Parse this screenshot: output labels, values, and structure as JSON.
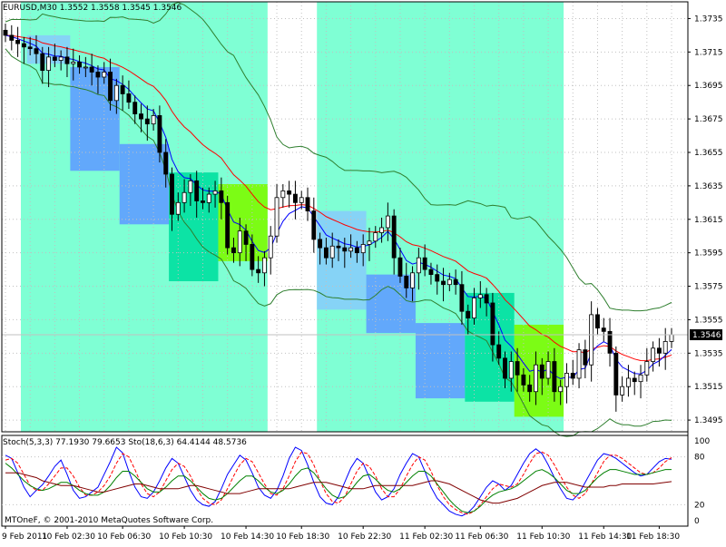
{
  "header": {
    "symbol_label": "EURUSD,M30  1.3552 1.3558 1.3545 1.3546"
  },
  "indicator_header": {
    "label": "Stoch(5,3,3) 77.1930 79.6653  Sto(18,6,3) 64.4144 48.5736"
  },
  "watermark": "MTOneF, © 2001-2010 MetaQuotes Software Corp.",
  "colors": {
    "background": "#ffffff",
    "grid": "#c0c0c0",
    "bull_candle": "#ffffff",
    "bear_candle": "#000000",
    "upper_band": "#2f7f2f",
    "lower_band": "#2f7f2f",
    "ema_red": "#ff0000",
    "ema_blue": "#0000ff",
    "session_zone": "#7fffd4",
    "box_blue": "#5f9fff",
    "box_lightblue": "#87cefa",
    "box_teal": "#00e0a0",
    "box_green": "#7cfc00",
    "stoch_main": "#0000ff",
    "stoch_signal": "#ff0000",
    "sto_slow": "#008000",
    "sto_slow_signal": "#800000"
  },
  "chart_data": [
    {
      "type": "candlestick",
      "title": "EURUSD,M30",
      "ylim": [
        1.3488,
        1.3745
      ],
      "y_ticks": [
        "1.3735",
        "1.3715",
        "1.3695",
        "1.3675",
        "1.3655",
        "1.3635",
        "1.3615",
        "1.3595",
        "1.3575",
        "1.3555",
        "1.3535",
        "1.3515",
        "1.3495"
      ],
      "current_price_label": "1.3546",
      "current_price": 1.3546,
      "x_tick_labels": [
        "9 Feb 2011",
        "10 Feb 02:30",
        "10 Feb 06:30",
        "10 Feb 10:30",
        "10 Feb 14:30",
        "10 Feb 18:30",
        "10 Feb 22:30",
        "11 Feb 02:30",
        "11 Feb 06:30",
        "11 Feb 10:30",
        "11 Feb 14:30",
        "11 Feb 18:30"
      ],
      "close": [
        1.3725,
        1.3722,
        1.372,
        1.3718,
        1.3717,
        1.3714,
        1.3704,
        1.3712,
        1.371,
        1.3712,
        1.3708,
        1.3709,
        1.3706,
        1.3706,
        1.3703,
        1.37,
        1.3703,
        1.3686,
        1.3695,
        1.369,
        1.3685,
        1.3678,
        1.3675,
        1.3672,
        1.3677,
        1.3655,
        1.3642,
        1.3618,
        1.3625,
        1.3631,
        1.3638,
        1.3626,
        1.3625,
        1.363,
        1.3632,
        1.3625,
        1.3598,
        1.3595,
        1.3608,
        1.36,
        1.3585,
        1.3583,
        1.3592,
        1.3605,
        1.3628,
        1.3632,
        1.363,
        1.3625,
        1.3628,
        1.362,
        1.3603,
        1.3598,
        1.3592,
        1.3599,
        1.3598,
        1.3596,
        1.3598,
        1.3595,
        1.36,
        1.3602,
        1.3607,
        1.361,
        1.3617,
        1.3592,
        1.3581,
        1.3574,
        1.3583,
        1.3592,
        1.3585,
        1.3582,
        1.3578,
        1.3576,
        1.3579,
        1.3576,
        1.356,
        1.3556,
        1.3568,
        1.357,
        1.3565,
        1.354,
        1.3532,
        1.352,
        1.353,
        1.3522,
        1.3516,
        1.3512,
        1.3528,
        1.352,
        1.353,
        1.3512,
        1.3515,
        1.3523,
        1.352,
        1.3537,
        1.3528,
        1.3558,
        1.355,
        1.3548,
        1.3535,
        1.351,
        1.3515,
        1.352,
        1.3518,
        1.3522,
        1.353,
        1.3538,
        1.3535,
        1.3542,
        1.3546
      ],
      "open": [
        1.3728,
        1.3725,
        1.3722,
        1.372,
        1.3718,
        1.3717,
        1.3714,
        1.3704,
        1.3712,
        1.371,
        1.3712,
        1.3708,
        1.3709,
        1.3706,
        1.3706,
        1.3703,
        1.37,
        1.3703,
        1.3686,
        1.3695,
        1.369,
        1.3685,
        1.3678,
        1.3675,
        1.3672,
        1.3677,
        1.3655,
        1.3642,
        1.3618,
        1.3625,
        1.3631,
        1.3638,
        1.3626,
        1.3625,
        1.363,
        1.3632,
        1.3625,
        1.3598,
        1.3595,
        1.3608,
        1.36,
        1.3585,
        1.3583,
        1.3592,
        1.3605,
        1.3628,
        1.3632,
        1.363,
        1.3625,
        1.3628,
        1.362,
        1.3603,
        1.3598,
        1.3592,
        1.3599,
        1.3598,
        1.3596,
        1.3598,
        1.3595,
        1.36,
        1.3602,
        1.3607,
        1.361,
        1.3617,
        1.3592,
        1.3581,
        1.3574,
        1.3583,
        1.3592,
        1.3585,
        1.3582,
        1.3578,
        1.3576,
        1.3579,
        1.3576,
        1.356,
        1.3556,
        1.3568,
        1.357,
        1.3565,
        1.354,
        1.3532,
        1.352,
        1.353,
        1.3522,
        1.3516,
        1.3512,
        1.3528,
        1.352,
        1.353,
        1.3512,
        1.3515,
        1.3523,
        1.352,
        1.3537,
        1.3528,
        1.3558,
        1.355,
        1.3548,
        1.3535,
        1.351,
        1.3515,
        1.352,
        1.3518,
        1.3522,
        1.353,
        1.3538,
        1.3535,
        1.3542
      ],
      "boxes": [
        {
          "x0": 4,
          "x1": 11,
          "y0": 1.3708,
          "y1": 1.3725,
          "color": "box_lightblue"
        },
        {
          "x0": 11,
          "x1": 19,
          "y0": 1.3644,
          "y1": 1.3706,
          "color": "box_blue"
        },
        {
          "x0": 19,
          "x1": 27,
          "y0": 1.3612,
          "y1": 1.366,
          "color": "box_blue"
        },
        {
          "x0": 27,
          "x1": 35,
          "y0": 1.3578,
          "y1": 1.3643,
          "color": "box_teal"
        },
        {
          "x0": 35,
          "x1": 43,
          "y0": 1.359,
          "y1": 1.3636,
          "color": "box_green"
        },
        {
          "x0": 51,
          "x1": 59,
          "y0": 1.3561,
          "y1": 1.362,
          "color": "box_lightblue"
        },
        {
          "x0": 59,
          "x1": 67,
          "y0": 1.3547,
          "y1": 1.3582,
          "color": "box_blue"
        },
        {
          "x0": 67,
          "x1": 75,
          "y0": 1.3508,
          "y1": 1.3553,
          "color": "box_blue"
        },
        {
          "x0": 75,
          "x1": 83,
          "y0": 1.3506,
          "y1": 1.3571,
          "color": "box_teal"
        },
        {
          "x0": 83,
          "x1": 91,
          "y0": 1.3497,
          "y1": 1.3552,
          "color": "box_green"
        }
      ],
      "session_zones": [
        [
          3,
          43
        ],
        [
          51,
          91
        ]
      ]
    },
    {
      "type": "line",
      "title": "Stochastic",
      "ylim": [
        0,
        100
      ],
      "y_ticks": [
        "100",
        "80",
        "20",
        "0"
      ],
      "series": [
        {
          "name": "Stoch(5,3,3)",
          "values": [
            82,
            78,
            60,
            42,
            30,
            38,
            45,
            56,
            68,
            76,
            58,
            38,
            28,
            30,
            36,
            42,
            58,
            74,
            92,
            85,
            62,
            42,
            30,
            28,
            36,
            50,
            66,
            78,
            72,
            55,
            38,
            26,
            20,
            18,
            24,
            40,
            58,
            70,
            82,
            76,
            60,
            42,
            32,
            28,
            38,
            56,
            78,
            92,
            88,
            70,
            48,
            30,
            22,
            20,
            30,
            48,
            66,
            78,
            72,
            54,
            36,
            26,
            30,
            40,
            58,
            72,
            84,
            80,
            62,
            42,
            28,
            20,
            12,
            8,
            6,
            10,
            18,
            30,
            42,
            50,
            46,
            38,
            44,
            58,
            72,
            84,
            90,
            84,
            70,
            54,
            40,
            28,
            26,
            34,
            48,
            62,
            76,
            84,
            82,
            78,
            72,
            66,
            60,
            56,
            58,
            66,
            74,
            78,
            77
          ]
        },
        {
          "name": "signal",
          "values": [
            76,
            78,
            72,
            58,
            44,
            38,
            38,
            46,
            56,
            66,
            66,
            56,
            42,
            32,
            32,
            36,
            44,
            56,
            72,
            84,
            80,
            64,
            46,
            34,
            30,
            36,
            50,
            64,
            72,
            68,
            56,
            40,
            28,
            22,
            20,
            26,
            40,
            56,
            70,
            78,
            74,
            60,
            46,
            34,
            32,
            40,
            56,
            74,
            86,
            84,
            70,
            50,
            34,
            24,
            22,
            30,
            46,
            62,
            72,
            68,
            56,
            40,
            30,
            30,
            40,
            56,
            70,
            80,
            76,
            62,
            44,
            30,
            20,
            14,
            10,
            8,
            12,
            20,
            30,
            40,
            46,
            44,
            42,
            46,
            58,
            72,
            84,
            86,
            82,
            70,
            56,
            42,
            32,
            28,
            34,
            46,
            60,
            74,
            82,
            82,
            78,
            72,
            66,
            60,
            58,
            60,
            66,
            74,
            79
          ]
        },
        {
          "name": "Sto(18,6,3)",
          "values": [
            72,
            66,
            58,
            50,
            44,
            40,
            38,
            40,
            44,
            48,
            48,
            44,
            38,
            34,
            32,
            32,
            36,
            44,
            54,
            62,
            62,
            56,
            48,
            40,
            36,
            36,
            42,
            50,
            56,
            56,
            50,
            42,
            34,
            28,
            26,
            28,
            34,
            42,
            50,
            56,
            56,
            50,
            42,
            36,
            34,
            38,
            46,
            56,
            64,
            66,
            60,
            50,
            40,
            32,
            28,
            30,
            38,
            48,
            56,
            58,
            52,
            44,
            38,
            36,
            40,
            48,
            56,
            62,
            62,
            56,
            46,
            36,
            26,
            18,
            12,
            10,
            12,
            18,
            26,
            32,
            36,
            38,
            40,
            44,
            50,
            56,
            62,
            64,
            60,
            54,
            46,
            38,
            34,
            34,
            38,
            46,
            54,
            60,
            64,
            64,
            62,
            60,
            58,
            58,
            58,
            60,
            62,
            64,
            64
          ]
        },
        {
          "name": "Sto(18,6,3) signal",
          "values": [
            60,
            60,
            60,
            58,
            56,
            54,
            50,
            48,
            46,
            44,
            44,
            44,
            42,
            40,
            38,
            36,
            36,
            38,
            40,
            42,
            44,
            46,
            46,
            44,
            42,
            40,
            40,
            40,
            40,
            42,
            44,
            44,
            42,
            40,
            38,
            36,
            34,
            34,
            34,
            36,
            38,
            40,
            40,
            40,
            40,
            40,
            40,
            42,
            44,
            46,
            48,
            48,
            48,
            46,
            44,
            42,
            40,
            40,
            40,
            42,
            44,
            44,
            44,
            44,
            44,
            44,
            44,
            46,
            48,
            50,
            50,
            48,
            46,
            42,
            38,
            34,
            30,
            26,
            24,
            22,
            22,
            24,
            26,
            28,
            32,
            36,
            40,
            44,
            46,
            48,
            48,
            48,
            46,
            44,
            42,
            42,
            42,
            42,
            44,
            44,
            46,
            46,
            46,
            46,
            46,
            46,
            47,
            48,
            49
          ]
        }
      ]
    }
  ]
}
